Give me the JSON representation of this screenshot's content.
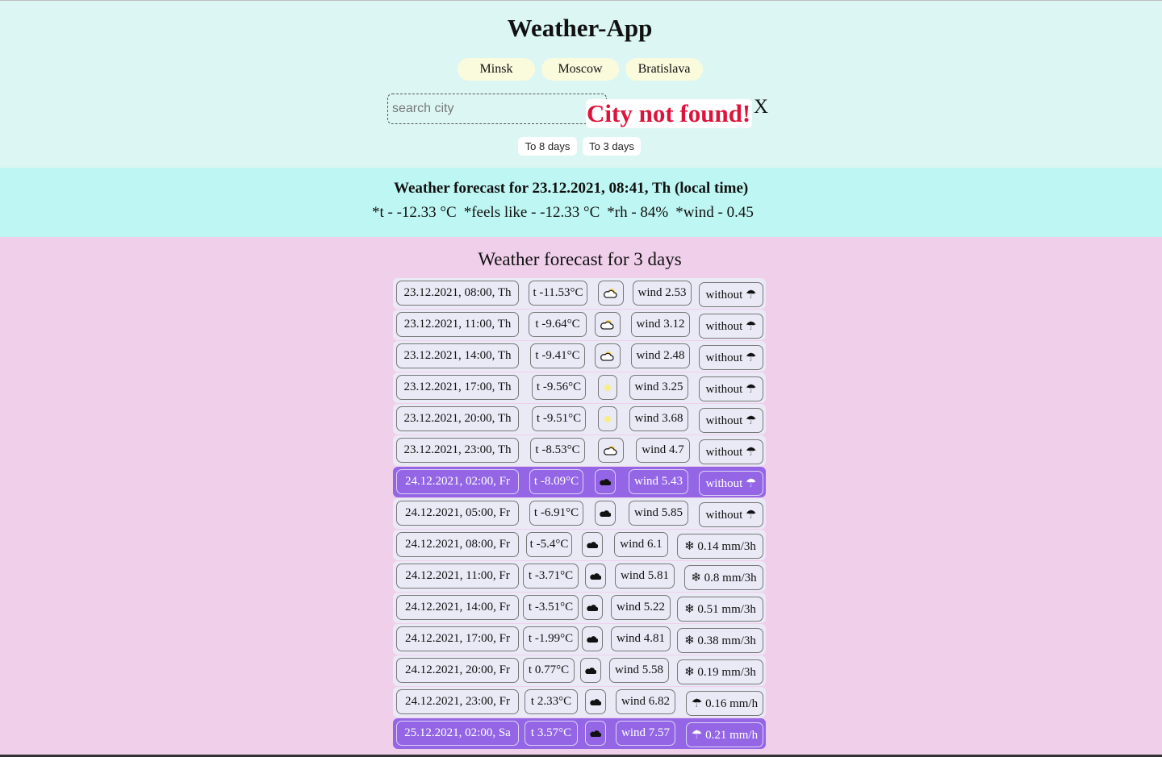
{
  "app": {
    "title": "Weather-App"
  },
  "cities": [
    "Minsk",
    "Moscow",
    "Bratislava"
  ],
  "search": {
    "placeholder": "search city",
    "value": ""
  },
  "error": {
    "message": "City not found!",
    "close": "X"
  },
  "range_buttons": [
    "To 8 days",
    "To 3 days"
  ],
  "current": {
    "title": "Weather forecast for 23.12.2021, 08:41, Th (local time)",
    "t": "*t - -12.33 °C",
    "feels": "*feels like - -12.33 °C",
    "rh": "*rh - 84%",
    "wind": "*wind - 0.45"
  },
  "forecast": {
    "title": "Weather forecast for 3 days",
    "rows": [
      {
        "date": "23.12.2021, 08:00, Th",
        "temp": "t -11.53°C",
        "icon": "partly-cloudy",
        "wind": "wind 2.53",
        "prec": "without ☂",
        "highlight": false
      },
      {
        "date": "23.12.2021, 11:00, Th",
        "temp": "t -9.64°C",
        "icon": "partly-cloudy",
        "wind": "wind 3.12",
        "prec": "without ☂",
        "highlight": false
      },
      {
        "date": "23.12.2021, 14:00, Th",
        "temp": "t -9.41°C",
        "icon": "partly-cloudy",
        "wind": "wind 2.48",
        "prec": "without ☂",
        "highlight": false
      },
      {
        "date": "23.12.2021, 17:00, Th",
        "temp": "t -9.56°C",
        "icon": "clear",
        "wind": "wind 3.25",
        "prec": "without ☂",
        "highlight": false
      },
      {
        "date": "23.12.2021, 20:00, Th",
        "temp": "t -9.51°C",
        "icon": "clear",
        "wind": "wind 3.68",
        "prec": "without ☂",
        "highlight": false
      },
      {
        "date": "23.12.2021, 23:00, Th",
        "temp": "t -8.53°C",
        "icon": "partly-cloudy",
        "wind": "wind 4.7",
        "prec": "without ☂",
        "highlight": false
      },
      {
        "date": "24.12.2021, 02:00, Fr",
        "temp": "t -8.09°C",
        "icon": "cloud",
        "wind": "wind 5.43",
        "prec": "without ☂",
        "highlight": true
      },
      {
        "date": "24.12.2021, 05:00, Fr",
        "temp": "t -6.91°C",
        "icon": "cloud",
        "wind": "wind 5.85",
        "prec": "without ☂",
        "highlight": false
      },
      {
        "date": "24.12.2021, 08:00, Fr",
        "temp": "t -5.4°C",
        "icon": "cloud",
        "wind": "wind 6.1",
        "prec": "❄ 0.14 mm/3h",
        "highlight": false
      },
      {
        "date": "24.12.2021, 11:00, Fr",
        "temp": "t -3.71°C",
        "icon": "cloud",
        "wind": "wind 5.81",
        "prec": "❄ 0.8 mm/3h",
        "highlight": false
      },
      {
        "date": "24.12.2021, 14:00, Fr",
        "temp": "t -3.51°C",
        "icon": "cloud",
        "wind": "wind 5.22",
        "prec": "❄ 0.51 mm/3h",
        "highlight": false
      },
      {
        "date": "24.12.2021, 17:00, Fr",
        "temp": "t -1.99°C",
        "icon": "cloud",
        "wind": "wind 4.81",
        "prec": "❄ 0.38 mm/3h",
        "highlight": false
      },
      {
        "date": "24.12.2021, 20:00, Fr",
        "temp": "t 0.77°C",
        "icon": "cloud",
        "wind": "wind 5.58",
        "prec": "❄ 0.19 mm/3h",
        "highlight": false
      },
      {
        "date": "24.12.2021, 23:00, Fr",
        "temp": "t 2.33°C",
        "icon": "cloud",
        "wind": "wind 6.82",
        "prec": "☂ 0.16 mm/h",
        "highlight": false
      },
      {
        "date": "25.12.2021, 02:00, Sa",
        "temp": "t 3.57°C",
        "icon": "cloud",
        "wind": "wind 7.57",
        "prec": "☂ 0.21 mm/h",
        "highlight": true
      }
    ]
  },
  "colors": {
    "header_bg": "#dcf7f3",
    "current_bg": "#bdf6f2",
    "forecast_bg": "#f0cfeb",
    "row_bg": "#eaeaf7",
    "row_highlight": "#9466e6",
    "error_text": "#dc143c",
    "city_button_bg": "#fafadc"
  }
}
